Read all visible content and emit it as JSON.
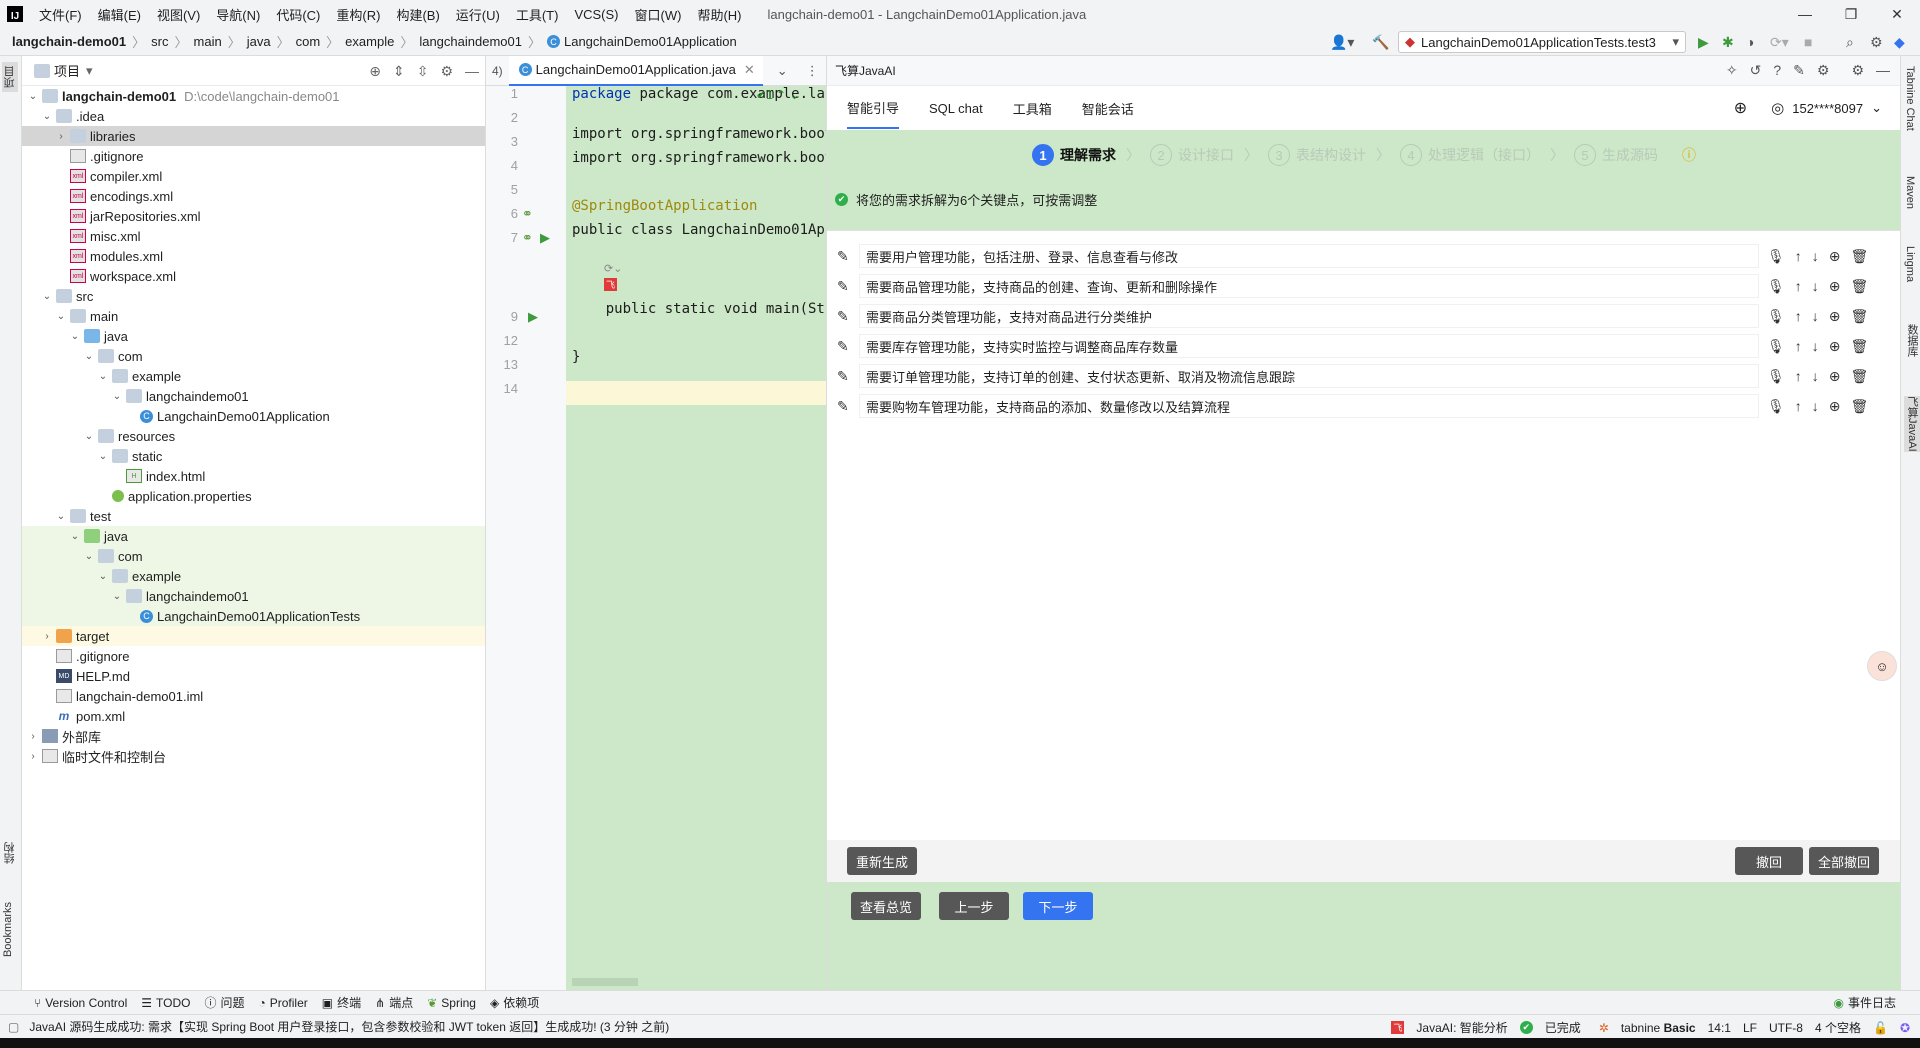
{
  "menu": {
    "items": [
      "文件(F)",
      "编辑(E)",
      "视图(V)",
      "导航(N)",
      "代码(C)",
      "重构(R)",
      "构建(B)",
      "运行(U)",
      "工具(T)",
      "VCS(S)",
      "窗口(W)",
      "帮助(H)"
    ],
    "window_title": "langchain-demo01 - LangchainDemo01Application.java"
  },
  "navbar": {
    "project": "langchain-demo01",
    "crumbs": [
      "src",
      "main",
      "java",
      "com",
      "example",
      "langchaindemo01",
      "LangchainDemo01Application"
    ],
    "run_config": "LangchainDemo01ApplicationTests.test3"
  },
  "left_stripe": {
    "project_tab": "项目",
    "structure_tab": "结构",
    "bookmarks_tab": "Bookmarks"
  },
  "project_panel": {
    "title": "项目",
    "tree": [
      {
        "label": "langchain-demo01",
        "path": "D:\\code\\langchain-demo01"
      },
      {
        "label": ".idea"
      },
      {
        "label": "libraries"
      },
      {
        "label": ".gitignore"
      },
      {
        "label": "compiler.xml"
      },
      {
        "label": "encodings.xml"
      },
      {
        "label": "jarRepositories.xml"
      },
      {
        "label": "misc.xml"
      },
      {
        "label": "modules.xml"
      },
      {
        "label": "workspace.xml"
      },
      {
        "label": "src"
      },
      {
        "label": "main"
      },
      {
        "label": "java"
      },
      {
        "label": "com"
      },
      {
        "label": "example"
      },
      {
        "label": "langchaindemo01"
      },
      {
        "label": "LangchainDemo01Application"
      },
      {
        "label": "resources"
      },
      {
        "label": "static"
      },
      {
        "label": "index.html"
      },
      {
        "label": "application.properties"
      },
      {
        "label": "test"
      },
      {
        "label": "java"
      },
      {
        "label": "com"
      },
      {
        "label": "example"
      },
      {
        "label": "langchaindemo01"
      },
      {
        "label": "LangchainDemo01ApplicationTests"
      },
      {
        "label": "target"
      },
      {
        "label": ".gitignore"
      },
      {
        "label": "HELP.md"
      },
      {
        "label": "langchain-demo01.iml"
      },
      {
        "label": "pom.xml"
      },
      {
        "label": "外部库"
      },
      {
        "label": "临时文件和控制台"
      }
    ]
  },
  "editor": {
    "tab_prefix": "4)",
    "tab": "LangchainDemo01Application.java",
    "inspection_count": "1",
    "line_numbers": [
      "1",
      "2",
      "3",
      "4",
      "5",
      "6",
      "7",
      "9",
      "12",
      "13",
      "14"
    ],
    "lines": {
      "l1": "package com.example.la",
      "l3": "import org.springframework.boot.",
      "l4": "import org.springframework.boot.",
      "l6": "@SpringBootApplication",
      "l7": "public class LangchainDemo01Appl",
      "l9": "    public static void main(Stri",
      "l13": "}"
    }
  },
  "ai_panel": {
    "title": "飞算JavaAI",
    "tabs": [
      "智能引导",
      "SQL chat",
      "工具箱",
      "智能会话"
    ],
    "user": "152****8097",
    "steps": [
      {
        "n": "1",
        "label": "理解需求"
      },
      {
        "n": "2",
        "label": "设计接口"
      },
      {
        "n": "3",
        "label": "表结构设计"
      },
      {
        "n": "4",
        "label": "处理逻辑（接口）"
      },
      {
        "n": "5",
        "label": "生成源码"
      }
    ],
    "notice": "将您的需求拆解为6个关键点，可按需调整",
    "requirements": [
      "需要用户管理功能，包括注册、登录、信息查看与修改",
      "需要商品管理功能，支持商品的创建、查询、更新和删除操作",
      "需要商品分类管理功能，支持对商品进行分类维护",
      "需要库存管理功能，支持实时监控与调整商品库存数量",
      "需要订单管理功能，支持订单的创建、支付状态更新、取消及物流信息跟踪",
      "需要购物车管理功能，支持商品的添加、数量修改以及结算流程"
    ],
    "buttons": {
      "regenerate": "重新生成",
      "undo": "撤回",
      "undo_all": "全部撤回",
      "overview": "查看总览",
      "prev": "上一步",
      "next": "下一步"
    }
  },
  "right_stripe": [
    "Tabnine Chat",
    "Maven",
    "Lingma",
    "数据库",
    "飞算JavaAI"
  ],
  "toolbar": {
    "items": [
      "Version Control",
      "TODO",
      "问题",
      "Profiler",
      "终端",
      "端点",
      "Spring",
      "依赖项"
    ],
    "event_log": "事件日志"
  },
  "status": {
    "message": "JavaAI 源码生成成功: 需求【实现 Spring Boot 用户登录接口，包含参数校验和 JWT token 返回】生成成功! (3 分钟 之前)",
    "ai_status": "JavaAI: 智能分析",
    "done": "已完成",
    "tabnine": "tabnine",
    "tabnine_plan": "Basic",
    "position": "14:1",
    "line_sep": "LF",
    "encoding": "UTF-8",
    "indent": "4 个空格"
  },
  "colors": {
    "accent": "#3574f0",
    "highlight_green": "#cde8c8",
    "success": "#2fae4c"
  }
}
